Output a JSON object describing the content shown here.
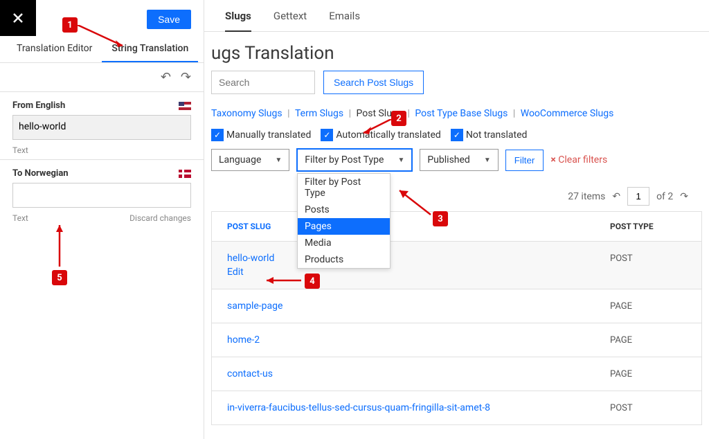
{
  "sidebar": {
    "save_label": "Save",
    "tabs": {
      "editor": "Translation Editor",
      "string": "String Translation"
    },
    "from_label": "From English",
    "from_value": "hello-world",
    "from_meta": "Text",
    "to_label": "To Norwegian",
    "to_value": "",
    "to_meta_left": "Text",
    "to_meta_right": "Discard changes"
  },
  "main": {
    "tabs": {
      "slugs": "Slugs",
      "gettext": "Gettext",
      "emails": "Emails"
    },
    "title": "ugs Translation",
    "search_placeholder": "Search",
    "search_btn": "Search Post Slugs",
    "subtabs": {
      "taxonomy": "Taxonomy Slugs",
      "term": "Term Slugs",
      "post": "Post Slugs",
      "posttype": "Post Type Base Slugs",
      "woo": "WooCommerce Slugs"
    },
    "checks": {
      "manual": "Manually translated",
      "auto": "Automatically translated",
      "not": "Not translated"
    },
    "dropdowns": {
      "lang": "Language",
      "filter": "Filter by Post Type",
      "status": "Published"
    },
    "menu": [
      "Filter by Post Type",
      "Posts",
      "Pages",
      "Media",
      "Products"
    ],
    "filter_btn": "Filter",
    "clear": "Clear filters",
    "pagination": {
      "items": "27 items",
      "page": "1",
      "total": "of 2"
    },
    "table_head": {
      "slug": "POST SLUG",
      "type": "POST TYPE"
    },
    "rows": [
      {
        "slug": "hello-world",
        "edit": "Edit",
        "type": "POST"
      },
      {
        "slug": "sample-page",
        "type": "PAGE"
      },
      {
        "slug": "home-2",
        "type": "PAGE"
      },
      {
        "slug": "contact-us",
        "type": "PAGE"
      },
      {
        "slug": "in-viverra-faucibus-tellus-sed-cursus-quam-fringilla-sit-amet-8",
        "type": "POST"
      }
    ]
  },
  "markers": {
    "m1": "1",
    "m2": "2",
    "m3": "3",
    "m4": "4",
    "m5": "5"
  }
}
